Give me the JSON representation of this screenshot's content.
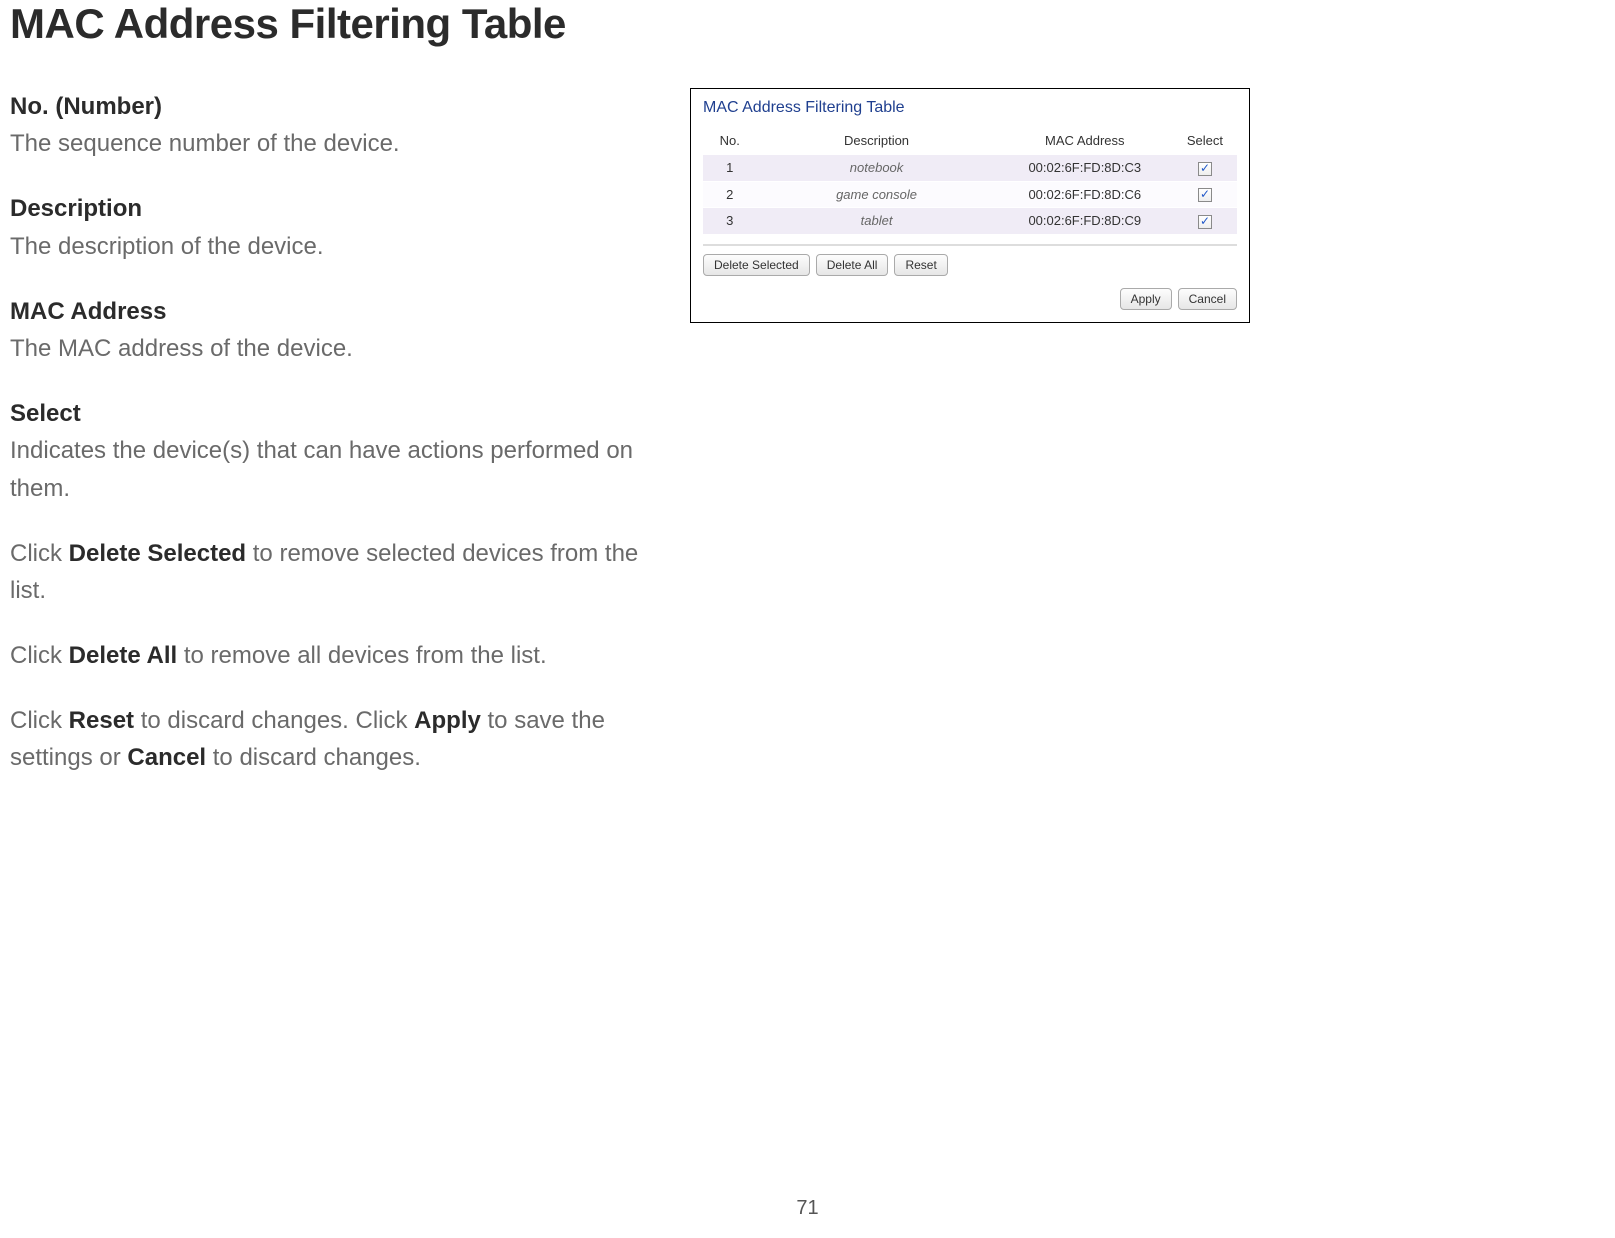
{
  "doc": {
    "title": "MAC Address Filtering Table",
    "defs": [
      {
        "label": "No. (Number)",
        "body": "The sequence number of the device."
      },
      {
        "label": "Description",
        "body": "The description of the device."
      },
      {
        "label": "MAC Address",
        "body": "The MAC address of the device."
      },
      {
        "label": "Select",
        "body": "Indicates the device(s) that can have actions performed on them."
      }
    ],
    "paras": {
      "p1_pre": "Click ",
      "p1_b": "Delete Selected",
      "p1_post": " to remove selected devices from the list.",
      "p2_pre": "Click ",
      "p2_b": "Delete All",
      "p2_post": " to remove all devices from the list.",
      "p3_pre": "Click ",
      "p3_b1": "Reset",
      "p3_mid1": " to discard changes. Click ",
      "p3_b2": "Apply",
      "p3_mid2": " to save the settings or ",
      "p3_b3": "Cancel",
      "p3_post": " to discard changes."
    },
    "page_number": "71"
  },
  "panel": {
    "title": "MAC Address Filtering Table",
    "columns": {
      "no": "No.",
      "desc": "Description",
      "mac": "MAC Address",
      "sel": "Select"
    },
    "rows": [
      {
        "no": "1",
        "desc": "notebook",
        "mac": "00:02:6F:FD:8D:C3",
        "selected": true
      },
      {
        "no": "2",
        "desc": "game console",
        "mac": "00:02:6F:FD:8D:C6",
        "selected": true
      },
      {
        "no": "3",
        "desc": "tablet",
        "mac": "00:02:6F:FD:8D:C9",
        "selected": true
      }
    ],
    "buttons": {
      "delete_selected": "Delete Selected",
      "delete_all": "Delete All",
      "reset": "Reset",
      "apply": "Apply",
      "cancel": "Cancel"
    }
  }
}
